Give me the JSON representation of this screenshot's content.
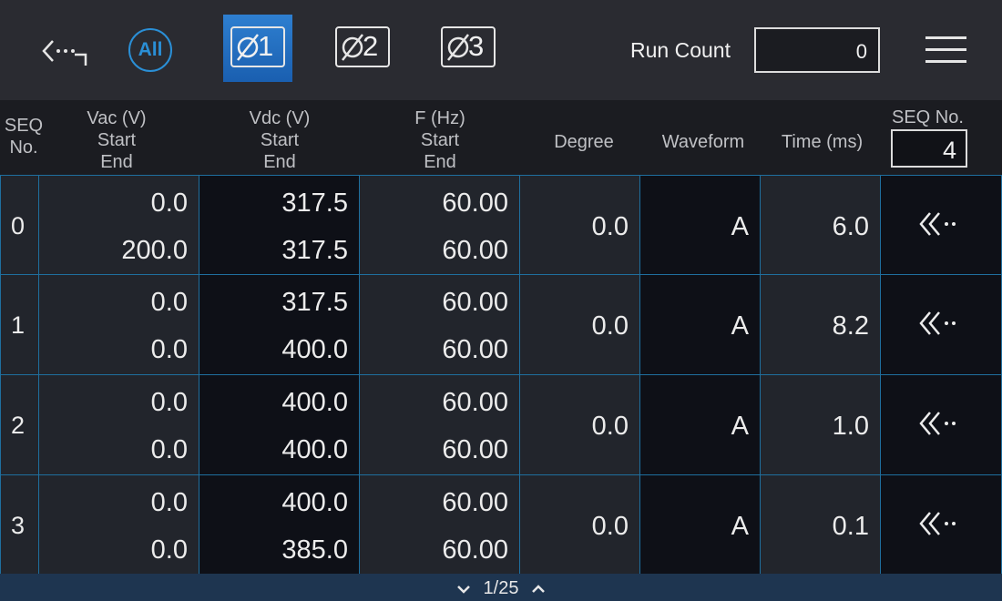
{
  "toolbar": {
    "back_icon": "back-arrow-icon",
    "all_label": "All",
    "phases": [
      {
        "label": "1",
        "active": true
      },
      {
        "label": "2",
        "active": false
      },
      {
        "label": "3",
        "active": false
      }
    ],
    "run_count_label": "Run Count",
    "run_count_value": "0",
    "menu_icon": "hamburger-menu-icon",
    "accent_color": "#2a8fd6"
  },
  "columns": {
    "seq": [
      "SEQ",
      "No."
    ],
    "vac": [
      "Vac (V)",
      "Start",
      "End"
    ],
    "vdc": [
      "Vdc (V)",
      "Start",
      "End"
    ],
    "freq": [
      "F (Hz)",
      "Start",
      "End"
    ],
    "degree": "Degree",
    "waveform": "Waveform",
    "time": "Time (ms)",
    "seq_no_label": "SEQ No.",
    "seq_no_value": "4"
  },
  "rows": [
    {
      "seq": "0",
      "vac_start": "0.0",
      "vac_end": "200.0",
      "vdc_start": "317.5",
      "vdc_end": "317.5",
      "f_start": "60.00",
      "f_end": "60.00",
      "degree": "0.0",
      "waveform": "A",
      "time": "6.0"
    },
    {
      "seq": "1",
      "vac_start": "0.0",
      "vac_end": "0.0",
      "vdc_start": "317.5",
      "vdc_end": "400.0",
      "f_start": "60.00",
      "f_end": "60.00",
      "degree": "0.0",
      "waveform": "A",
      "time": "8.2"
    },
    {
      "seq": "2",
      "vac_start": "0.0",
      "vac_end": "0.0",
      "vdc_start": "400.0",
      "vdc_end": "400.0",
      "f_start": "60.00",
      "f_end": "60.00",
      "degree": "0.0",
      "waveform": "A",
      "time": "1.0"
    },
    {
      "seq": "3",
      "vac_start": "0.0",
      "vac_end": "0.0",
      "vdc_start": "400.0",
      "vdc_end": "385.0",
      "f_start": "60.00",
      "f_end": "60.00",
      "degree": "0.0",
      "waveform": "A",
      "time": "0.1"
    }
  ],
  "footer": {
    "page": "1/25"
  }
}
